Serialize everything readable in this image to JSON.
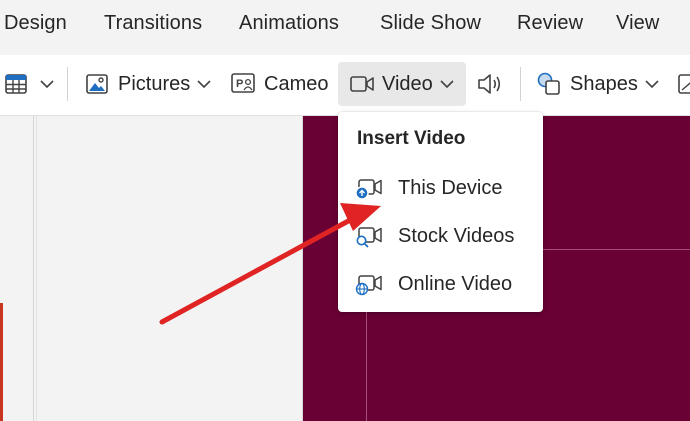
{
  "ribbon": {
    "tabs": [
      {
        "label": "Design"
      },
      {
        "label": "Transitions"
      },
      {
        "label": "Animations"
      },
      {
        "label": "Slide Show"
      },
      {
        "label": "Review"
      },
      {
        "label": "View"
      }
    ]
  },
  "toolbar": {
    "pictures_label": "Pictures",
    "cameo_label": "Cameo",
    "video_label": "Video",
    "shapes_label": "Shapes"
  },
  "video_menu": {
    "title": "Insert Video",
    "items": [
      {
        "label": "This Device",
        "icon": "video-upload-icon"
      },
      {
        "label": "Stock Videos",
        "icon": "video-search-icon"
      },
      {
        "label": "Online Video",
        "icon": "video-globe-icon"
      }
    ]
  },
  "colors": {
    "slide_background": "#6a0134",
    "accent_blue": "#1e6fc2",
    "annotation_arrow": "#e02323"
  }
}
